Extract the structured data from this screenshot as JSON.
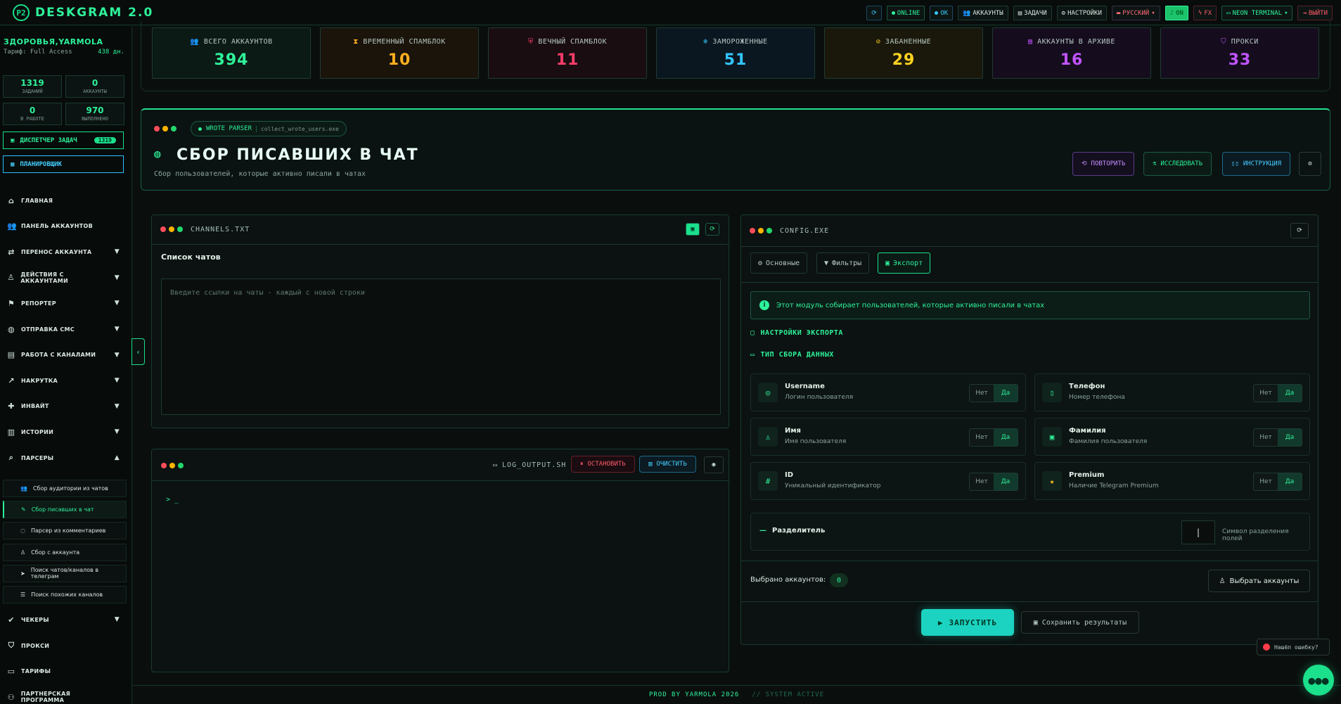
{
  "app": {
    "title": "DESKGRAM 2.0",
    "logo": "P2"
  },
  "topbar": {
    "online": "ONLINE",
    "ok": "OK",
    "accounts": "АККАУНТЫ",
    "tasks": "ЗАДАЧИ",
    "settings": "НАСТРОЙКИ",
    "lang": "РУССКИЙ",
    "on": "ON",
    "fx": "FX",
    "theme": "NEON TERMINAL",
    "logout": "ВЫЙТИ"
  },
  "sidebar": {
    "user": "ЗДОРОВЬЯ,YARMOLA",
    "plan": "Тариф: Full Access",
    "days": "438 дн.",
    "stats": [
      {
        "value": "1319",
        "label": "ЗАДАНИЙ"
      },
      {
        "value": "0",
        "label": "АККАУНТЫ"
      },
      {
        "value": "0",
        "label": "В РАБОТЕ"
      },
      {
        "value": "970",
        "label": "ВЫПОЛНЕНО"
      }
    ],
    "dispatcher": "ДИСПЕТЧЕР ЗАДАЧ",
    "dispatcher_badge": "1319",
    "planner": "ПЛАНИРОВЩИК",
    "nav": [
      {
        "label": "ГЛАВНАЯ",
        "icon": "home-icon",
        "caret": ""
      },
      {
        "label": "ПАНЕЛЬ АККАУНТОВ",
        "icon": "users-icon",
        "caret": ""
      },
      {
        "label": "ПЕРЕНОС АККАУНТА",
        "icon": "user-transfer-icon",
        "caret": "▼"
      },
      {
        "label": "ДЕЙСТВИЯ С АККАУНТАМИ",
        "icon": "user-actions-icon",
        "caret": "▼"
      },
      {
        "label": "РЕПОРТЕР",
        "icon": "flag-icon",
        "caret": "▼"
      },
      {
        "label": "ОТПРАВКА СМС",
        "icon": "chat-icon",
        "caret": "▼"
      },
      {
        "label": "РАБОТА С КАНАЛАМИ",
        "icon": "inbox-icon",
        "caret": "▼"
      },
      {
        "label": "НАКРУТКА",
        "icon": "chart-icon",
        "caret": "▼"
      },
      {
        "label": "ИНВАЙТ",
        "icon": "invite-icon",
        "caret": "▼"
      },
      {
        "label": "ИСТОРИИ",
        "icon": "stories-icon",
        "caret": "▼"
      },
      {
        "label": "ПАРСЕРЫ",
        "icon": "search-icon",
        "caret": "▲"
      }
    ],
    "subnav": [
      {
        "label": "Сбор аудитории из чатов",
        "icon": "users-icon"
      },
      {
        "label": "Сбор писавших в чат",
        "icon": "pencil-icon"
      },
      {
        "label": "Парсер из комментариев",
        "icon": "comment-icon"
      },
      {
        "label": "Сбор с аккаунта",
        "icon": "user-icon"
      },
      {
        "label": "Поиск чатов/каналов в телеграм",
        "icon": "telegram-icon"
      },
      {
        "label": "Поиск похожих каналов",
        "icon": "database-icon"
      }
    ],
    "nav2": [
      {
        "label": "ЧЕКЕРЫ",
        "icon": "check-icon",
        "caret": "▼"
      },
      {
        "label": "ПРОКСИ",
        "icon": "shield-icon",
        "caret": ""
      },
      {
        "label": "ТАРИФЫ",
        "icon": "card-icon",
        "caret": ""
      },
      {
        "label": "ПАРТНЕРСКАЯ ПРОГРАММА",
        "icon": "partner-icon",
        "caret": ""
      }
    ]
  },
  "kpis": [
    {
      "label": "ВСЕГО АККАУНТОВ",
      "value": "394",
      "color": "#2ef29a",
      "icon": "users-icon",
      "glyph": "👥"
    },
    {
      "label": "ВРЕМЕННЫЙ СПАМБЛОК",
      "value": "10",
      "color": "#ffb020",
      "icon": "hourglass-icon",
      "glyph": "⧗"
    },
    {
      "label": "ВЕЧНЫЙ СПАМБЛОК",
      "value": "11",
      "color": "#ff3d6a",
      "icon": "shield-alert-icon",
      "glyph": "⛨"
    },
    {
      "label": "ЗАМОРОЖЕННЫЕ",
      "value": "51",
      "color": "#33c6ff",
      "icon": "snowflake-icon",
      "glyph": "❄"
    },
    {
      "label": "ЗАБАНЕННЫЕ",
      "value": "29",
      "color": "#ffd21f",
      "icon": "ban-icon",
      "glyph": "⊘"
    },
    {
      "label": "АККАУНТЫ В АРХИВЕ",
      "value": "16",
      "color": "#c154ff",
      "icon": "archive-icon",
      "glyph": "▤"
    },
    {
      "label": "ПРОКСИ",
      "value": "33",
      "color": "#c154ff",
      "icon": "shield-icon",
      "glyph": "⛉"
    }
  ],
  "header": {
    "tag": "WROTE PARSER",
    "tag_sub": "collect_wrote_users.exe",
    "title": "СБОР ПИСАВШИХ В ЧАТ",
    "subtitle": "Сбор пользователей, которые активно писали в чатах",
    "repeat": "ПОВТОРИТЬ",
    "explore": "ИССЛЕДОВАТЬ",
    "guide": "ИНСТРУКЦИЯ"
  },
  "channels": {
    "file": "CHANNELS.TXT",
    "title": "Список чатов",
    "placeholder": "Введите ссылки на чаты - каждый с новой строки"
  },
  "log": {
    "file": "LOG_OUTPUT.SH",
    "stop": "ОСТАНОВИТЬ",
    "clear": "ОЧИСТИТЬ",
    "prompt": "> _"
  },
  "config": {
    "file": "CONFIG.EXE",
    "tabs": [
      "Основные",
      "Фильтры",
      "Экспорт"
    ],
    "info": "Этот модуль собирает пользователей, которые активно писали в чатах",
    "export_settings": "НАСТРОЙКИ ЭКСПОРТА",
    "data_type": "ТИП СБОРА ДАННЫХ",
    "options": [
      {
        "title": "Username",
        "sub": "Логин пользователя",
        "icon": "at-icon",
        "glyph": "◎",
        "no": "Нет",
        "yes": "Да"
      },
      {
        "title": "Телефон",
        "sub": "Номер телефона",
        "icon": "phone-icon",
        "glyph": "▯",
        "no": "Нет",
        "yes": "Да"
      },
      {
        "title": "Имя",
        "sub": "Имя пользователя",
        "icon": "user-icon",
        "glyph": "♙",
        "no": "Нет",
        "yes": "Да"
      },
      {
        "title": "Фамилия",
        "sub": "Фамилия пользователя",
        "icon": "id-card-icon",
        "glyph": "▣",
        "no": "Нет",
        "yes": "Да"
      },
      {
        "title": "ID",
        "sub": "Уникальный идентификатор",
        "icon": "hash-icon",
        "glyph": "#",
        "no": "Нет",
        "yes": "Да"
      },
      {
        "title": "Premium",
        "sub": "Наличие Telegram Premium",
        "icon": "star-icon",
        "glyph": "★",
        "no": "Нет",
        "yes": "Да"
      }
    ],
    "separator_label": "Разделитель",
    "separator_value": "|",
    "separator_hint": "Символ разделения полей",
    "selected_label": "Выбрано аккаунтов:",
    "selected_count": "0",
    "choose": "Выбрать аккаунты",
    "run": "ЗАПУСТИТЬ",
    "save": "Сохранить результаты"
  },
  "footer": {
    "text": "PROD BY YARMOLA 2026",
    "status": "// SYSTEM ACTIVE"
  },
  "bug": "Нашёл ошибку?"
}
